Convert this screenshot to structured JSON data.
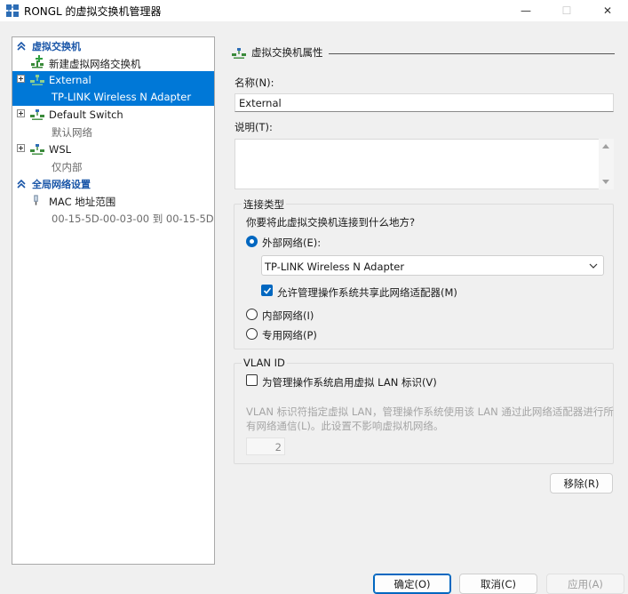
{
  "window": {
    "title": "RONGL 的虚拟交换机管理器",
    "minimize_glyph": "—",
    "maximize_glyph": "☐",
    "close_glyph": "✕"
  },
  "sidebar": {
    "section_virtual_switches": "虚拟交换机",
    "new_switch_label": "新建虚拟网络交换机",
    "switches": [
      {
        "name": "External",
        "subtitle": "TP-LINK Wireless N Adapter",
        "selected": true
      },
      {
        "name": "Default Switch",
        "subtitle": "默认网络",
        "selected": false
      },
      {
        "name": "WSL",
        "subtitle": "仅内部",
        "selected": false
      }
    ],
    "section_global": "全局网络设置",
    "mac_range_label": "MAC 地址范围",
    "mac_range_value": "00-15-5D-00-03-00 到 00-15-5D-..."
  },
  "properties": {
    "header": "虚拟交换机属性",
    "name_label": "名称(N):",
    "name_value": "External",
    "notes_label": "说明(T):",
    "notes_value": "",
    "connection_type": {
      "title": "连接类型",
      "question": "你要将此虚拟交换机连接到什么地方?",
      "external_label": "外部网络(E):",
      "adapter_selected": "TP-LINK Wireless N Adapter",
      "allow_share_label": "允许管理操作系统共享此网络适配器(M)",
      "allow_share_checked": true,
      "internal_label": "内部网络(I)",
      "private_label": "专用网络(P)",
      "selected": "external"
    },
    "vlan": {
      "title": "VLAN ID",
      "enable_label": "为管理操作系统启用虚拟 LAN 标识(V)",
      "enable_checked": false,
      "description_line1": "VLAN 标识符指定虚拟 LAN，管理操作系统使用该 LAN 通过此网络适配器进行所",
      "description_line2": "有网络通信(L)。此设置不影响虚拟机网络。",
      "value": "2"
    },
    "remove_button": "移除(R)"
  },
  "footer": {
    "ok": "确定(O)",
    "cancel": "取消(C)",
    "apply": "应用(A)"
  },
  "colors": {
    "accent": "#0067c0",
    "selection": "#0078d7",
    "section_header": "#1a56a8"
  }
}
